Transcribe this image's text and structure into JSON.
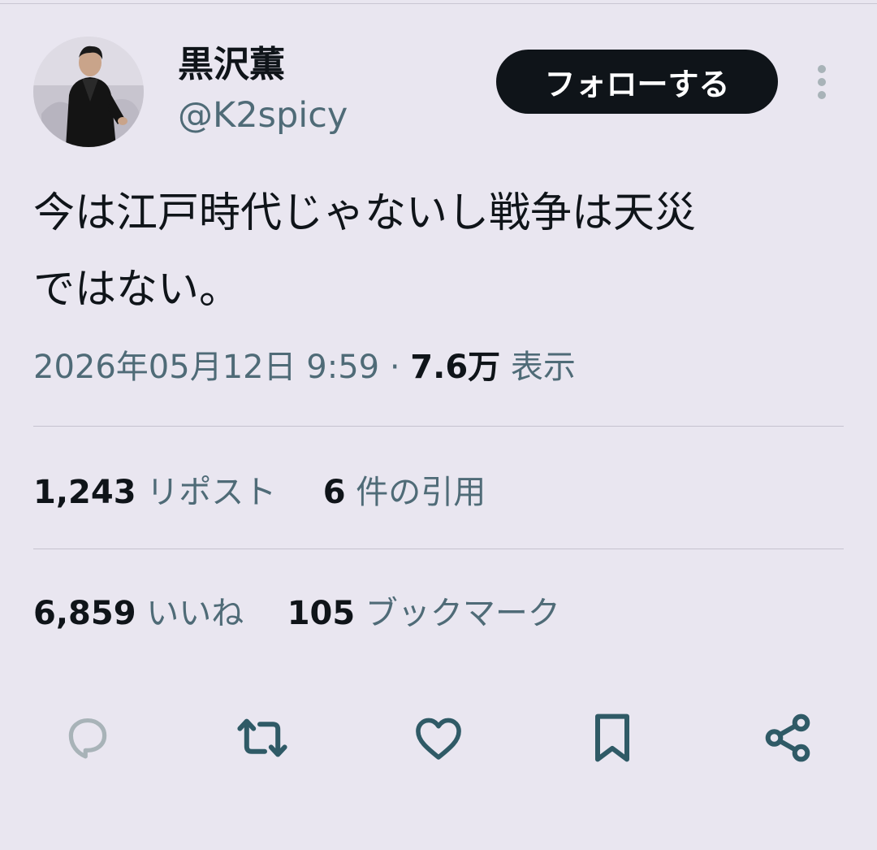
{
  "header": {
    "display_name": "黒沢薫",
    "handle": "@K2spicy",
    "follow_label": "フォローする"
  },
  "tweet": {
    "text_line1": "今は江戸時代じゃないし戦争は天災",
    "text_line2": "ではない。",
    "timestamp": "2026年05月12日 9:59",
    "separator": "·",
    "views_count": "7.6万",
    "views_label": "表示"
  },
  "stats": {
    "reposts_count": "1,243",
    "reposts_label": "リポスト",
    "quotes_count": "6",
    "quotes_label": "件の引用",
    "likes_count": "6,859",
    "likes_label": "いいね",
    "bookmarks_count": "105",
    "bookmarks_label": "ブックマーク"
  },
  "actions": [
    "reply-icon",
    "retweet-icon",
    "heart-icon",
    "bookmark-icon",
    "share-icon"
  ],
  "colors": {
    "background": "#e9e6f0",
    "text_primary": "#0f1419",
    "text_secondary": "#4f6b77",
    "icon_active": "#2f5a66",
    "icon_muted": "#a8b3b8",
    "follow_button_bg": "#0f1419",
    "follow_button_text": "#ffffff"
  }
}
